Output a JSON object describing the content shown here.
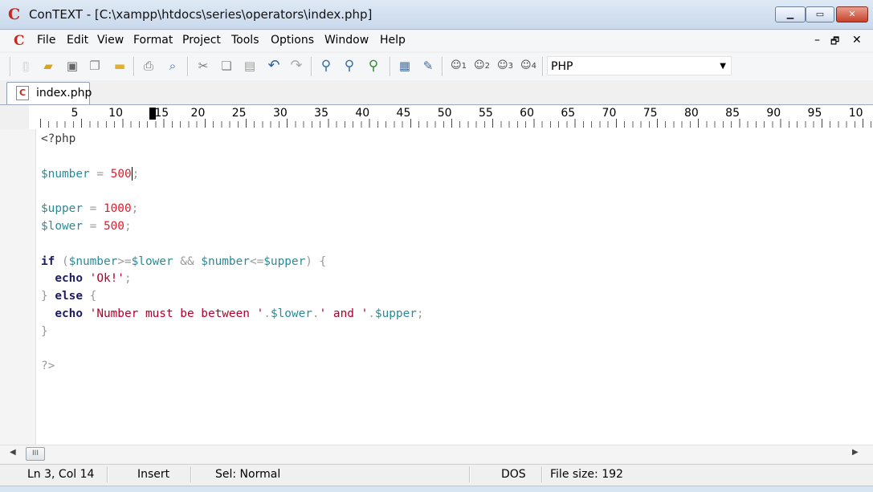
{
  "window": {
    "title": "ConTEXT - [C:\\xampp\\htdocs\\series\\operators\\index.php]",
    "logo_glyph": "C",
    "controls": {
      "minimize": "▁",
      "maximize": "▭",
      "close": "✕"
    },
    "accent": "#c8281e"
  },
  "menu": {
    "items": [
      "File",
      "Edit",
      "View",
      "Format",
      "Project",
      "Tools",
      "Options",
      "Window",
      "Help"
    ],
    "mdi_controls": {
      "minimize": "–",
      "restore": "🗗",
      "close": "✕"
    }
  },
  "toolbar": {
    "icons": [
      "new-file-icon",
      "open-file-icon",
      "save-icon",
      "save-all-icon",
      "open-folder-icon",
      "print-icon",
      "print-preview-icon",
      "cut-icon",
      "copy-icon",
      "paste-icon",
      "undo-icon",
      "redo-icon",
      "find-icon",
      "find-next-icon",
      "replace-icon",
      "file-properties-icon",
      "tools-icon",
      "user-command-1-icon",
      "user-command-2-icon",
      "user-command-3-icon",
      "user-command-4-icon"
    ],
    "user_command_numbers": [
      "1",
      "2",
      "3",
      "4"
    ],
    "language_select": {
      "value": "PHP"
    }
  },
  "tabs": [
    {
      "label": "index.php",
      "active": true
    }
  ],
  "ruler": {
    "numbers": [
      "5",
      "10",
      "15",
      "20",
      "25",
      "30",
      "35",
      "40",
      "45",
      "50",
      "55",
      "60",
      "65",
      "70",
      "75",
      "80",
      "85",
      "90",
      "95",
      "10"
    ],
    "cursor_column": 14
  },
  "editor": {
    "lines": [
      [
        {
          "t": "<?php",
          "c": "default"
        }
      ],
      [],
      [
        {
          "t": "$number",
          "c": "var"
        },
        {
          "t": " = ",
          "c": "op"
        },
        {
          "t": "500",
          "c": "num"
        },
        {
          "t": "CARET",
          "c": "caret"
        },
        {
          "t": ";",
          "c": "op"
        }
      ],
      [],
      [
        {
          "t": "$upper",
          "c": "var"
        },
        {
          "t": " = ",
          "c": "op"
        },
        {
          "t": "1000",
          "c": "num"
        },
        {
          "t": ";",
          "c": "op"
        }
      ],
      [
        {
          "t": "$lower",
          "c": "var"
        },
        {
          "t": " = ",
          "c": "op"
        },
        {
          "t": "500",
          "c": "num"
        },
        {
          "t": ";",
          "c": "op"
        }
      ],
      [],
      [
        {
          "t": "if",
          "c": "kw"
        },
        {
          "t": " (",
          "c": "op"
        },
        {
          "t": "$number",
          "c": "var"
        },
        {
          "t": ">=",
          "c": "op"
        },
        {
          "t": "$lower",
          "c": "var"
        },
        {
          "t": " && ",
          "c": "op"
        },
        {
          "t": "$number",
          "c": "var"
        },
        {
          "t": "<=",
          "c": "op"
        },
        {
          "t": "$upper",
          "c": "var"
        },
        {
          "t": ") {",
          "c": "op"
        }
      ],
      [
        {
          "t": "  ",
          "c": "op"
        },
        {
          "t": "echo",
          "c": "kw"
        },
        {
          "t": " ",
          "c": "op"
        },
        {
          "t": "'Ok!'",
          "c": "str"
        },
        {
          "t": ";",
          "c": "op"
        }
      ],
      [
        {
          "t": "} ",
          "c": "op"
        },
        {
          "t": "else",
          "c": "kw"
        },
        {
          "t": " {",
          "c": "op"
        }
      ],
      [
        {
          "t": "  ",
          "c": "op"
        },
        {
          "t": "echo",
          "c": "kw"
        },
        {
          "t": " ",
          "c": "op"
        },
        {
          "t": "'Number must be between '",
          "c": "str"
        },
        {
          "t": ".",
          "c": "op"
        },
        {
          "t": "$lower",
          "c": "var"
        },
        {
          "t": ".",
          "c": "op"
        },
        {
          "t": "' and '",
          "c": "str"
        },
        {
          "t": ".",
          "c": "op"
        },
        {
          "t": "$upper",
          "c": "var"
        },
        {
          "t": ";",
          "c": "op"
        }
      ],
      [
        {
          "t": "}",
          "c": "op"
        }
      ],
      [],
      [
        {
          "t": "?>",
          "c": "op"
        }
      ]
    ]
  },
  "scrollbar": {
    "thumb_label": "III"
  },
  "statusbar": {
    "position": "Ln 3, Col 14",
    "mode": "Insert",
    "selection": "Sel: Normal",
    "line_endings": "DOS",
    "file_size": "File size: 192"
  }
}
